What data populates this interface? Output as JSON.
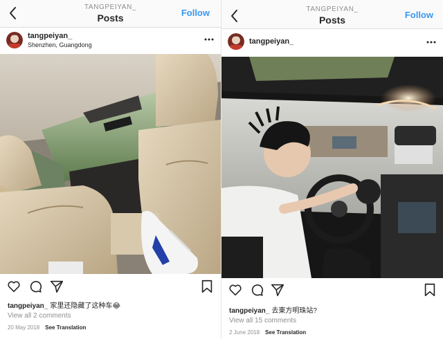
{
  "left": {
    "header": {
      "username": "TANGPEIYAN_",
      "title": "Posts",
      "follow_label": "Follow"
    },
    "post": {
      "author": "tangpeiyan_",
      "location": "Shenzhen, Guangdong",
      "caption_user": "tangpeiyan_",
      "caption_text": "家里还隐藏了这种车😂",
      "comments_link": "View all 2 comments",
      "date": "20 May 2018",
      "see_translation": "See Translation"
    }
  },
  "right": {
    "header": {
      "username": "TANGPEIYAN_",
      "title": "Posts",
      "follow_label": "Follow"
    },
    "post": {
      "author": "tangpeiyan_",
      "caption_user": "tangpeiyan_",
      "caption_text": "去東方明珠站?",
      "comments_link": "View all 15 comments",
      "date": "2 June 2018",
      "see_translation": "See Translation"
    }
  },
  "colors": {
    "link_blue": "#3897f0",
    "text": "#262626",
    "muted": "#8e8e8e",
    "divider": "#dbdbdb"
  },
  "icons": [
    "back-arrow-icon",
    "more-options-icon",
    "heart-icon",
    "comment-icon",
    "share-icon",
    "bookmark-icon"
  ]
}
